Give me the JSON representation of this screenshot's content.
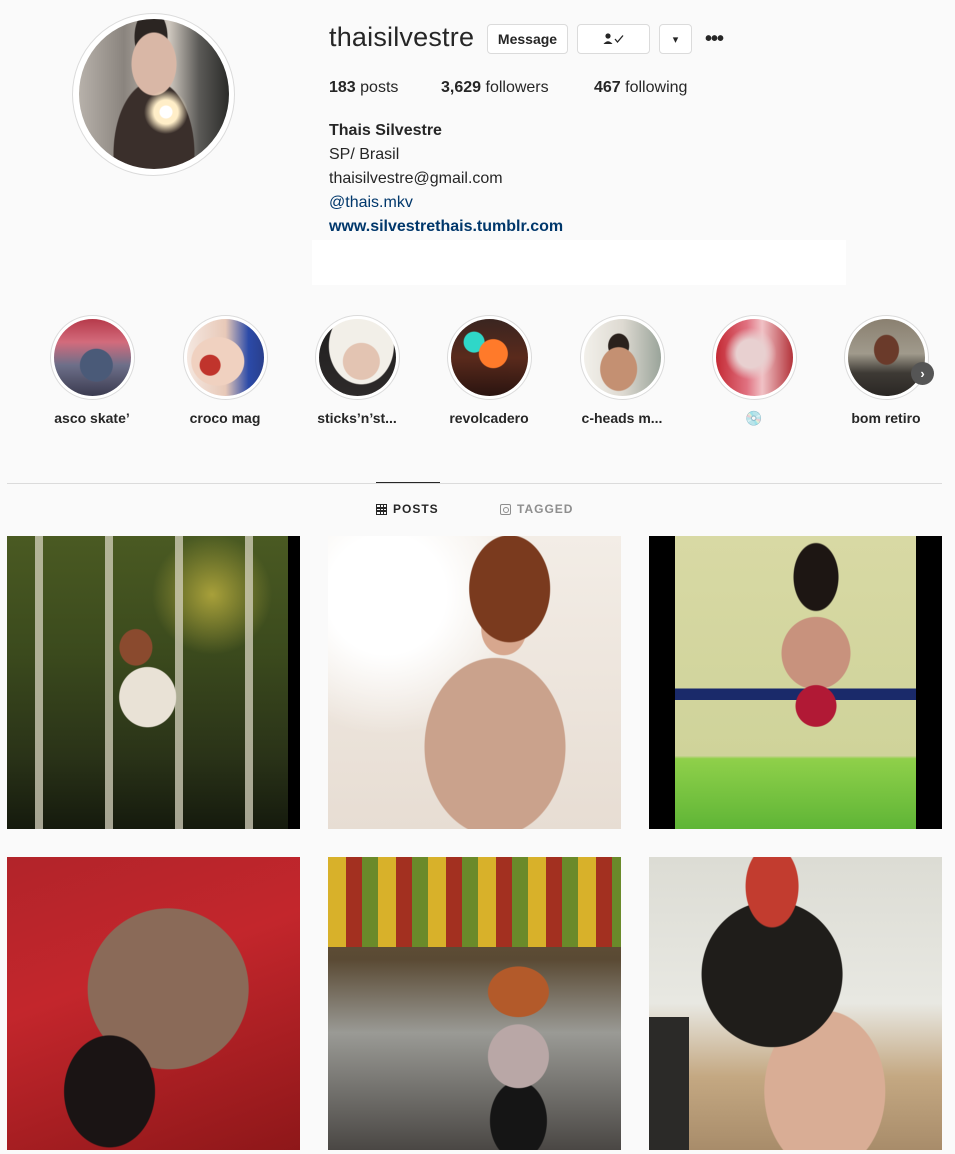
{
  "profile": {
    "username": "thaisilvestre",
    "buttons": {
      "message": "Message",
      "dropdown": "▾",
      "more": "•••"
    },
    "stats": [
      {
        "count": "183",
        "label": "posts"
      },
      {
        "count": "3,629",
        "label": "followers"
      },
      {
        "count": "467",
        "label": "following"
      }
    ],
    "bio": {
      "name": "Thais Silvestre",
      "location": "SP/ Brasil",
      "email": "thaisilvestre@gmail.com",
      "mention": "@thais.mkv",
      "website": "www.silvestrethais.tumblr.com"
    }
  },
  "highlights": [
    {
      "label": "asco skate’"
    },
    {
      "label": "croco mag"
    },
    {
      "label": "sticks’n’st..."
    },
    {
      "label": "revolcadero"
    },
    {
      "label": "c-heads m..."
    },
    {
      "label": "💿"
    },
    {
      "label": "bom retiro"
    }
  ],
  "tabs": {
    "posts": "POSTS",
    "tagged": "TAGGED"
  },
  "icons": {
    "avatar": "profile-photo",
    "follow": "user-check-icon",
    "next": "chevron-right-icon",
    "posts_tab": "grid-icon",
    "tagged_tab": "tag-icon"
  },
  "posts_count_shown": 6
}
